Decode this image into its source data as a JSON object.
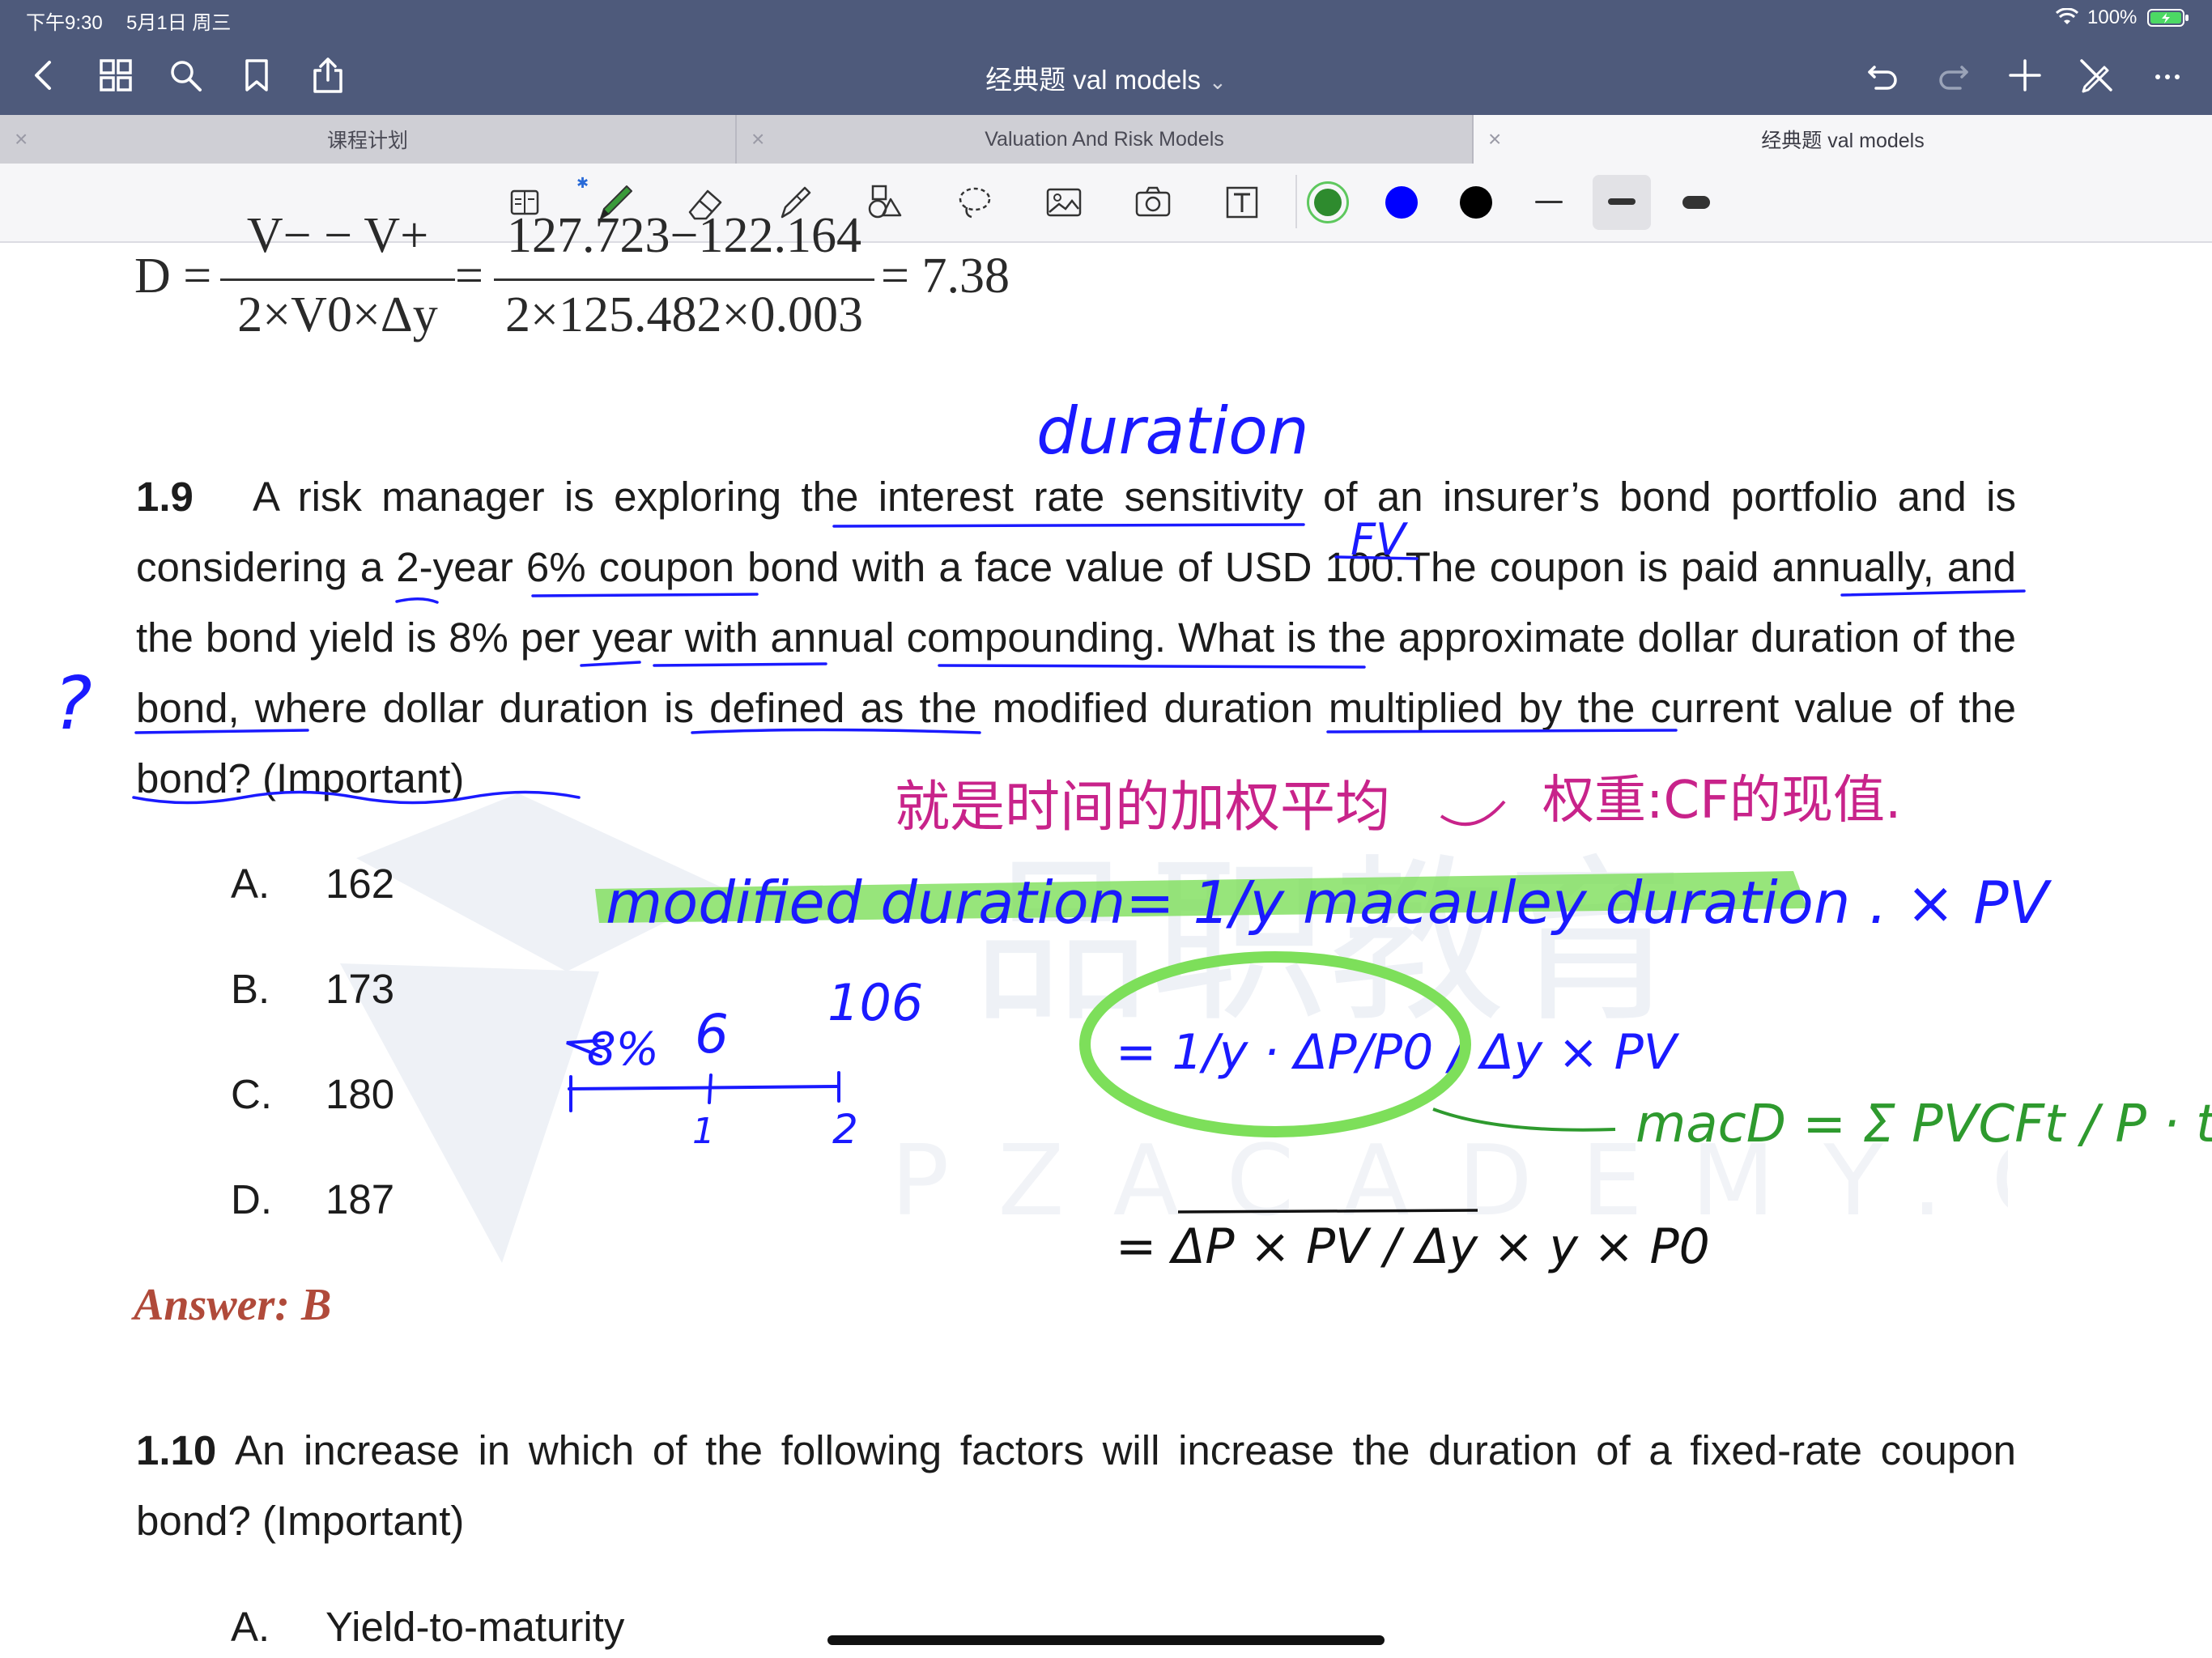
{
  "status": {
    "time": "下午9:30",
    "date": "5月1日 周三",
    "battery": "100%"
  },
  "header": {
    "title": "经典题 val models",
    "icons": [
      "back-icon",
      "grid-icon",
      "search-icon",
      "bookmark-icon",
      "share-icon",
      "undo-icon",
      "redo-icon",
      "add-icon",
      "pen-off-icon",
      "more-icon"
    ]
  },
  "tabs": [
    {
      "label": "课程计划",
      "active": false
    },
    {
      "label": "Valuation And Risk Models",
      "active": false
    },
    {
      "label": "经典题 val models",
      "active": true
    }
  ],
  "toolbar": {
    "tools": [
      "read-mode-icon",
      "pen-icon",
      "eraser-icon",
      "highlighter-icon",
      "shapes-icon",
      "lasso-icon",
      "image-icon",
      "camera-icon",
      "text-icon"
    ],
    "colors": [
      "#2e8b2e",
      "#0000ff",
      "#000000"
    ],
    "stroke_sizes": [
      "thin",
      "medium",
      "thick"
    ]
  },
  "document": {
    "formula": {
      "lhs": "D",
      "frac1_top": "V− − V+",
      "frac1_bottom": "2×V0×Δy",
      "frac2_top": "127.723−122.164",
      "frac2_bottom": "2×125.482×0.003",
      "result": "7.38"
    },
    "q19": {
      "number": "1.9",
      "text": "A risk manager is exploring the interest rate sensitivity of an insurer’s bond portfolio and is considering a 2-year 6% coupon bond with a face value of USD 100.The coupon is paid annually, and the bond yield is 8% per year with annual compounding. What is the approximate dollar duration of the bond, where dollar duration is defined as the modified duration multiplied by the current value of the bond? (Important)",
      "options": [
        {
          "letter": "A.",
          "value": "162"
        },
        {
          "letter": "B.",
          "value": "173"
        },
        {
          "letter": "C.",
          "value": "180"
        },
        {
          "letter": "D.",
          "value": "187"
        }
      ],
      "answer": "Answer: B"
    },
    "q110": {
      "number": "1.10",
      "text": "An increase in which of the following factors will increase the duration of a fixed-rate coupon bond? (Important)",
      "options": [
        {
          "letter": "A.",
          "value": "Yield-to-maturity"
        }
      ]
    }
  },
  "handwriting": {
    "duration": "duration",
    "fv": "FV",
    "question_mark": "?",
    "chinese_note": "就是时间的加权平均",
    "weight_note": "权重:CF的现值.",
    "modified": "modified duration= 1/y  macauley duration . × PV",
    "timeline_rate": "8%",
    "timeline_cf1": "6",
    "timeline_cf2": "106",
    "timeline_t1": "1",
    "timeline_t2": "2",
    "step1": "= 1/y · ΔP/P0 / Δy  × PV",
    "step2": "= ΔP × PV / Δy × y × P0",
    "macd": "macD = Σ PVCFt / P · t"
  }
}
